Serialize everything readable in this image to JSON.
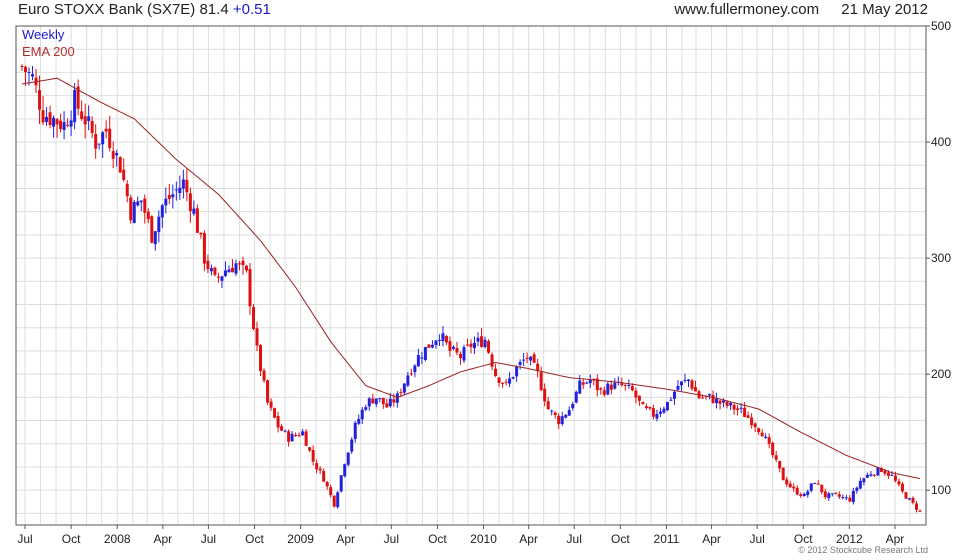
{
  "header": {
    "title": "Euro STOXX Bank (SX7E) 81.4",
    "change": "+0.51",
    "site": "www.fullermoney.com",
    "date": "21 May 2012"
  },
  "copyright": "© 2012 Stockcube Research Ltd",
  "colors": {
    "up": "#2222dd",
    "down": "#dd1111",
    "ema": "#992222",
    "grid": "#dddddd",
    "frame": "#555555"
  },
  "chart_data": {
    "type": "candlestick",
    "legend": [
      "Weekly",
      "EMA 200"
    ],
    "legend_position": "top-left",
    "grid": true,
    "ylim": [
      70,
      500
    ],
    "y_ticks": [
      100,
      200,
      300,
      400,
      500
    ],
    "x_ticks": [
      "Jul",
      "Oct",
      "2008",
      "Apr",
      "Jul",
      "Oct",
      "2009",
      "Apr",
      "Jul",
      "Oct",
      "2010",
      "Apr",
      "Jul",
      "Oct",
      "2011",
      "Apr",
      "Jul",
      "Oct",
      "2012",
      "Apr"
    ],
    "x_start": "2007-06-25",
    "x_end": "2012-05-21",
    "close_path": [
      [
        "2007-06-25",
        465
      ],
      [
        "2007-07-16",
        455
      ],
      [
        "2007-08-06",
        425
      ],
      [
        "2007-08-27",
        420
      ],
      [
        "2007-09-17",
        415
      ],
      [
        "2007-10-08",
        435
      ],
      [
        "2007-10-29",
        420
      ],
      [
        "2007-11-19",
        400
      ],
      [
        "2007-12-10",
        410
      ],
      [
        "2008-01-07",
        380
      ],
      [
        "2008-01-28",
        340
      ],
      [
        "2008-02-18",
        350
      ],
      [
        "2008-03-10",
        320
      ],
      [
        "2008-03-31",
        345
      ],
      [
        "2008-04-21",
        355
      ],
      [
        "2008-05-12",
        365
      ],
      [
        "2008-06-02",
        340
      ],
      [
        "2008-06-23",
        300
      ],
      [
        "2008-07-14",
        280
      ],
      [
        "2008-08-04",
        290
      ],
      [
        "2008-08-25",
        295
      ],
      [
        "2008-09-15",
        285
      ],
      [
        "2008-10-06",
        220
      ],
      [
        "2008-10-27",
        175
      ],
      [
        "2008-11-17",
        155
      ],
      [
        "2008-12-08",
        145
      ],
      [
        "2009-01-05",
        150
      ],
      [
        "2009-01-26",
        125
      ],
      [
        "2009-02-16",
        110
      ],
      [
        "2009-03-09",
        88
      ],
      [
        "2009-03-30",
        125
      ],
      [
        "2009-04-20",
        155
      ],
      [
        "2009-05-11",
        175
      ],
      [
        "2009-06-01",
        180
      ],
      [
        "2009-06-22",
        172
      ],
      [
        "2009-07-13",
        180
      ],
      [
        "2009-08-03",
        200
      ],
      [
        "2009-08-24",
        215
      ],
      [
        "2009-09-14",
        225
      ],
      [
        "2009-10-05",
        235
      ],
      [
        "2009-10-26",
        220
      ],
      [
        "2009-11-16",
        215
      ],
      [
        "2009-12-07",
        225
      ],
      [
        "2010-01-04",
        230
      ],
      [
        "2010-01-25",
        200
      ],
      [
        "2010-02-15",
        190
      ],
      [
        "2010-03-08",
        205
      ],
      [
        "2010-03-29",
        215
      ],
      [
        "2010-04-19",
        200
      ],
      [
        "2010-05-10",
        170
      ],
      [
        "2010-05-31",
        160
      ],
      [
        "2010-06-21",
        170
      ],
      [
        "2010-07-12",
        190
      ],
      [
        "2010-08-02",
        195
      ],
      [
        "2010-08-23",
        185
      ],
      [
        "2010-09-13",
        190
      ],
      [
        "2010-10-04",
        190
      ],
      [
        "2010-10-25",
        185
      ],
      [
        "2010-11-15",
        170
      ],
      [
        "2010-12-06",
        165
      ],
      [
        "2011-01-03",
        175
      ],
      [
        "2011-01-24",
        190
      ],
      [
        "2011-02-14",
        195
      ],
      [
        "2011-03-07",
        180
      ],
      [
        "2011-03-28",
        180
      ],
      [
        "2011-04-18",
        175
      ],
      [
        "2011-05-09",
        172
      ],
      [
        "2011-05-30",
        168
      ],
      [
        "2011-06-20",
        160
      ],
      [
        "2011-07-11",
        150
      ],
      [
        "2011-08-01",
        130
      ],
      [
        "2011-08-22",
        110
      ],
      [
        "2011-09-12",
        100
      ],
      [
        "2011-10-03",
        95
      ],
      [
        "2011-10-24",
        108
      ],
      [
        "2011-11-14",
        95
      ],
      [
        "2011-12-05",
        95
      ],
      [
        "2012-01-02",
        92
      ],
      [
        "2012-01-23",
        108
      ],
      [
        "2012-02-13",
        115
      ],
      [
        "2012-03-05",
        118
      ],
      [
        "2012-03-26",
        112
      ],
      [
        "2012-04-16",
        98
      ],
      [
        "2012-05-07",
        88
      ],
      [
        "2012-05-21",
        81.4
      ]
    ],
    "ema_path": [
      [
        "2007-06-25",
        450
      ],
      [
        "2007-09-03",
        455
      ],
      [
        "2007-11-26",
        435
      ],
      [
        "2008-02-04",
        420
      ],
      [
        "2008-04-28",
        385
      ],
      [
        "2008-07-21",
        355
      ],
      [
        "2008-10-13",
        315
      ],
      [
        "2008-12-22",
        275
      ],
      [
        "2009-03-02",
        228
      ],
      [
        "2009-05-11",
        190
      ],
      [
        "2009-07-13",
        180
      ],
      [
        "2009-09-14",
        190
      ],
      [
        "2009-11-16",
        202
      ],
      [
        "2010-01-25",
        210
      ],
      [
        "2010-03-29",
        205
      ],
      [
        "2010-06-21",
        197
      ],
      [
        "2010-09-27",
        193
      ],
      [
        "2011-01-03",
        187
      ],
      [
        "2011-04-04",
        180
      ],
      [
        "2011-07-04",
        170
      ],
      [
        "2011-09-26",
        150
      ],
      [
        "2011-12-26",
        130
      ],
      [
        "2012-03-26",
        115
      ],
      [
        "2012-05-21",
        110
      ]
    ]
  }
}
